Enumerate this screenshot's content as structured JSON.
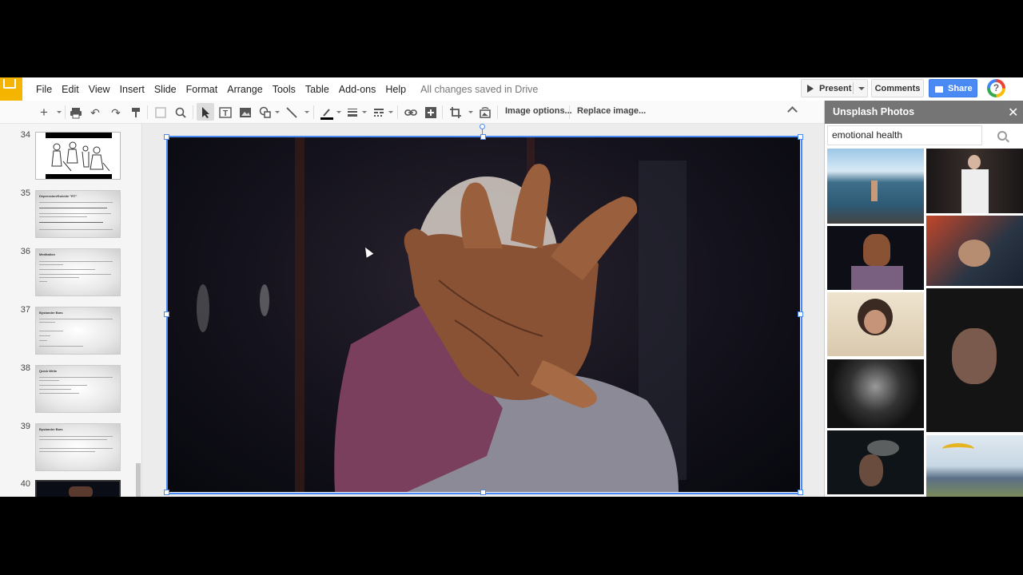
{
  "menu": [
    "File",
    "Edit",
    "View",
    "Insert",
    "Slide",
    "Format",
    "Arrange",
    "Tools",
    "Table",
    "Add-ons",
    "Help"
  ],
  "save_status": "All changes saved in Drive",
  "header": {
    "present": "Present",
    "comments": "Comments",
    "share": "Share",
    "help": "?"
  },
  "toolbar": {
    "image_options": "Image options...",
    "replace_image": "Replace image..."
  },
  "slides": [
    {
      "number": "34",
      "title": ""
    },
    {
      "number": "35",
      "title": "Depression/Suicide \"RT\""
    },
    {
      "number": "36",
      "title": "Meditation"
    },
    {
      "number": "37",
      "title": "Bystander Bars"
    },
    {
      "number": "38",
      "title": "Quick Write"
    },
    {
      "number": "39",
      "title": "Bystander Bars"
    },
    {
      "number": "40",
      "title": ""
    }
  ],
  "panel": {
    "title": "Unsplash Photos",
    "close": "✕",
    "search_value": "emotional health",
    "photos": [
      "man-on-boat-photo",
      "woman-white-jacket-photo",
      "reaching-hand-photo",
      "woman-car-seat-photo",
      "woman-crying-photo",
      "hands-covering-face-photo",
      "woman-dark-portrait-photo",
      "man-smoking-photo",
      "paraglider-photo"
    ]
  },
  "colors": {
    "selection": "#4a8af4",
    "share_button": "#4a8af4",
    "panel_header": "#757575",
    "logo": "#f4b400"
  }
}
